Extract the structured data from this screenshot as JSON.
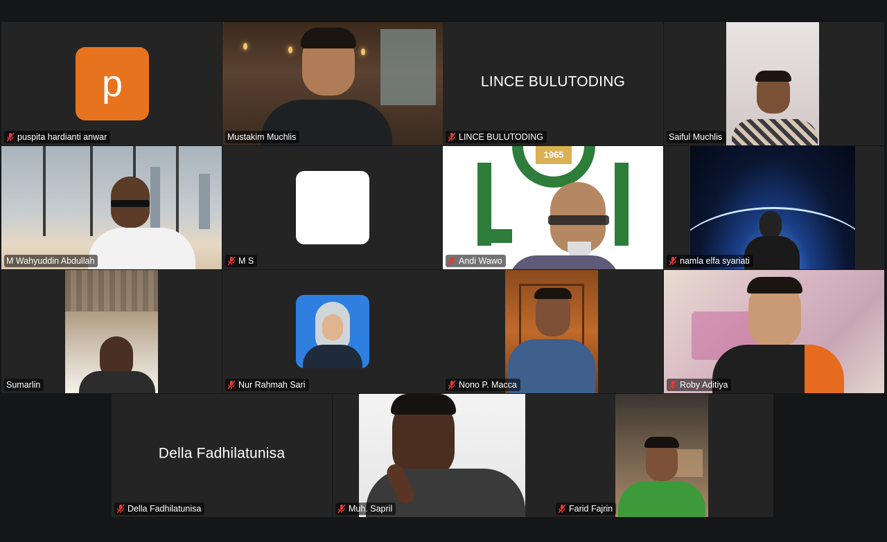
{
  "participants": [
    {
      "display_name": "puspita hardianti anwar",
      "avatar_letter": "p",
      "muted": true
    },
    {
      "display_name": "Mustakim Muchlis",
      "muted": false,
      "speaking": true
    },
    {
      "display_name": "LINCE BULUTODING",
      "big_name": "LINCE BULUTODING",
      "muted": true
    },
    {
      "display_name": "Saiful Muchlis",
      "muted": false
    },
    {
      "display_name": "M Wahyuddin Abdullah",
      "muted": false
    },
    {
      "display_name": "M S",
      "muted": true
    },
    {
      "display_name": "Andi Wawo",
      "logo_year": "1965",
      "muted": true
    },
    {
      "display_name": "namla elfa syariati",
      "muted": true
    },
    {
      "display_name": "Sumarlin",
      "muted": false
    },
    {
      "display_name": "Nur Rahmah Sari",
      "muted": true
    },
    {
      "display_name": "Nono P. Macca",
      "muted": true
    },
    {
      "display_name": "Roby Aditiya",
      "muted": true
    },
    {
      "display_name": "Della Fadhilatunisa",
      "big_name": "Della Fadhilatunisa",
      "muted": true
    },
    {
      "display_name": "Muh. Sapril",
      "muted": true
    },
    {
      "display_name": "Farid Fajrin",
      "muted": true
    }
  ],
  "colors": {
    "background": "#141618",
    "tile": "#242424",
    "active_speaker_border": "#6fd05a",
    "avatar_orange": "#e8731e",
    "mute_red": "#e03a3a"
  },
  "icons": {
    "mute": "microphone-muted-icon"
  }
}
